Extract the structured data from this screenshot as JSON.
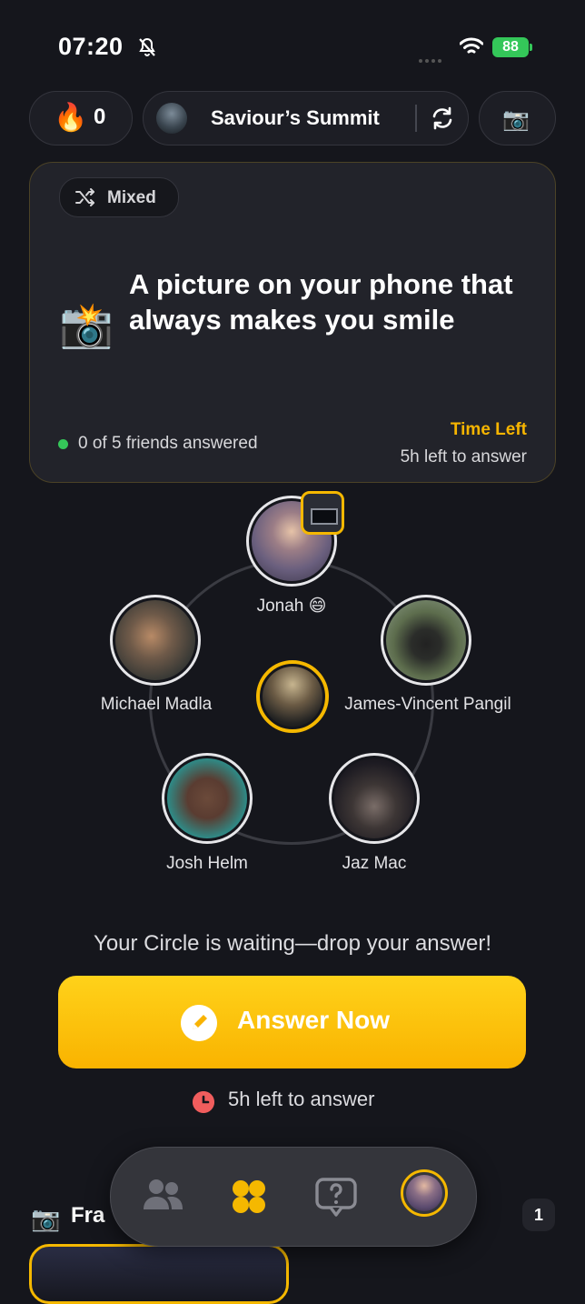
{
  "status_bar": {
    "time": "07:20",
    "battery": "88"
  },
  "header": {
    "streak_count": "0",
    "circle_name": "Saviour’s Summit"
  },
  "question_card": {
    "category": "Mixed",
    "question": "A picture on your phone that always makes you smile",
    "answered_text": "0 of 5 friends answered",
    "time_left_label": "Time Left",
    "time_left_value": "5h left to answer"
  },
  "friends": [
    {
      "name": "Jonah 😄"
    },
    {
      "name": "Michael Madla"
    },
    {
      "name": "James-Vincent Pangil"
    },
    {
      "name": "Josh Helm"
    },
    {
      "name": "Jaz Mac"
    }
  ],
  "cta": {
    "waiting_text": "Your Circle is waiting—drop your answer!",
    "button_label": "Answer Now",
    "timer_text": "5h left to answer"
  },
  "bottom": {
    "section_title": "Fra",
    "count": "1"
  },
  "icons": [
    "bell-slash-icon",
    "wifi-icon",
    "fire-icon",
    "refresh-icon",
    "camera-icon",
    "shuffle-icon",
    "pencil-icon",
    "clock-icon",
    "people-icon",
    "grid-icon",
    "question-icon"
  ],
  "colors": {
    "accent": "#f5b800",
    "background": "#15161c",
    "card": "#22232a",
    "online": "#35c759",
    "timer": "#f05d5d"
  }
}
